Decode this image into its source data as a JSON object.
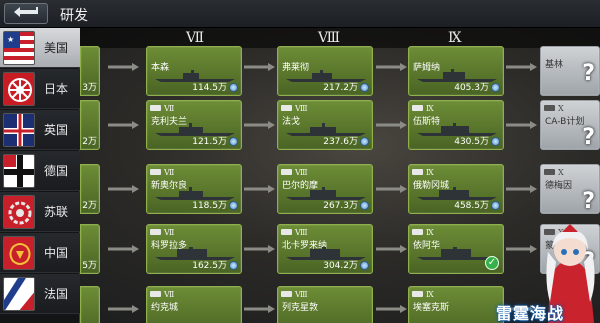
{
  "header": {
    "title": "研发"
  },
  "tiers": [
    "Ⅶ",
    "Ⅷ",
    "Ⅸ"
  ],
  "nations": [
    {
      "label": "美国",
      "icon": "us-flag-icon",
      "active": true
    },
    {
      "label": "日本",
      "icon": "japan-emblem-icon",
      "active": false
    },
    {
      "label": "英国",
      "icon": "uk-ensign-icon",
      "active": false
    },
    {
      "label": "德国",
      "icon": "germany-ensign-icon",
      "active": false
    },
    {
      "label": "苏联",
      "icon": "soviet-emblem-icon",
      "active": false
    },
    {
      "label": "中国",
      "icon": "china-emblem-icon",
      "active": false
    },
    {
      "label": "法国",
      "icon": "france-flag-icon",
      "active": false
    }
  ],
  "rows": [
    {
      "partial_price": "3万",
      "cards": [
        {
          "name": "本森",
          "price": "114.5万",
          "tier": "",
          "locked": false,
          "checked": false
        },
        {
          "name": "弗莱彻",
          "price": "217.2万",
          "tier": "",
          "locked": false,
          "checked": false
        },
        {
          "name": "萨姆纳",
          "price": "405.3万",
          "tier": "",
          "locked": false,
          "checked": false
        },
        {
          "name": "基林",
          "price": "",
          "tier": "",
          "locked": true,
          "checked": false
        }
      ]
    },
    {
      "partial_price": "2万",
      "cards": [
        {
          "name": "克利夫兰",
          "price": "121.5万",
          "tier": "Ⅶ",
          "locked": false,
          "checked": false
        },
        {
          "name": "法戈",
          "price": "237.6万",
          "tier": "Ⅷ",
          "locked": false,
          "checked": false
        },
        {
          "name": "伍斯特",
          "price": "430.5万",
          "tier": "Ⅸ",
          "locked": false,
          "checked": false
        },
        {
          "name": "CA-B计划",
          "price": "",
          "tier": "Ⅹ",
          "locked": true,
          "checked": false
        }
      ]
    },
    {
      "partial_price": "2万",
      "cards": [
        {
          "name": "新奥尔良",
          "price": "118.5万",
          "tier": "Ⅶ",
          "locked": false,
          "checked": false
        },
        {
          "name": "巴尔的摩",
          "price": "267.3万",
          "tier": "Ⅷ",
          "locked": false,
          "checked": false
        },
        {
          "name": "俄勒冈城",
          "price": "458.5万",
          "tier": "Ⅸ",
          "locked": false,
          "checked": false
        },
        {
          "name": "德梅因",
          "price": "",
          "tier": "Ⅹ",
          "locked": true,
          "checked": false
        }
      ]
    },
    {
      "partial_price": "5万",
      "cards": [
        {
          "name": "科罗拉多",
          "price": "162.5万",
          "tier": "Ⅶ",
          "locked": false,
          "checked": false
        },
        {
          "name": "北卡罗来纳",
          "price": "304.2万",
          "tier": "Ⅷ",
          "locked": false,
          "checked": false
        },
        {
          "name": "依阿华",
          "price": "",
          "tier": "Ⅸ",
          "locked": false,
          "checked": true
        },
        {
          "name": "蒙大拿",
          "price": "",
          "tier": "Ⅹ",
          "locked": true,
          "checked": false
        }
      ]
    },
    {
      "partial_price": "",
      "cards": [
        {
          "name": "约克城",
          "price": "",
          "tier": "Ⅶ",
          "locked": false,
          "checked": false
        },
        {
          "name": "列克星敦",
          "price": "",
          "tier": "Ⅷ",
          "locked": false,
          "checked": false
        },
        {
          "name": "埃塞克斯",
          "price": "",
          "tier": "Ⅸ",
          "locked": false,
          "checked": false
        },
        {
          "name": "",
          "price": "",
          "tier": "",
          "locked": true,
          "checked": false
        }
      ]
    }
  ],
  "logo": {
    "text": "雷霆海战"
  },
  "colors": {
    "card_green": "#5e7d2f",
    "locked_gray": "#b9bdc1",
    "check_green": "#36b14b"
  }
}
